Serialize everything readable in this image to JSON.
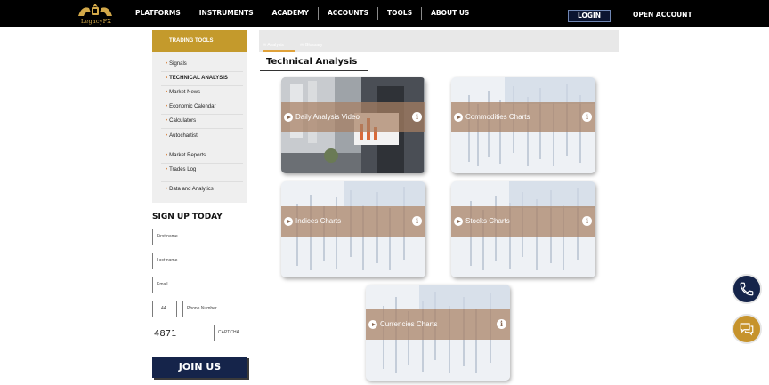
{
  "header": {
    "brand": "LegacyFX",
    "nav": [
      "PLATFORMS",
      "INSTRUMENTS",
      "ACADEMY",
      "ACCOUNTS",
      "TOOLS",
      "ABOUT US"
    ],
    "login_label": "LOGIN",
    "open_account_label": "OPEN ACCOUNT"
  },
  "sidebar": {
    "title": "TRADING TOOLS",
    "items": [
      "Signals",
      "TECHNICAL ANALYSIS",
      "Market News",
      "Economic Calendar",
      "Calculators",
      "Autochartist",
      "Market Reports",
      "Trades Log",
      "Data and Analytics"
    ],
    "active_index": 1
  },
  "signup": {
    "title": "SIGN UP TODAY",
    "first_name_placeholder": "First name",
    "last_name_placeholder": "Last name",
    "email_placeholder": "Email",
    "phone_code_value": "44",
    "phone_placeholder": "Phone Number",
    "captcha_value": "4871",
    "captcha_placeholder": "CAPTCHA",
    "join_label": "JOIN US"
  },
  "main": {
    "tabs": [
      "Analysis",
      "Glossary"
    ],
    "section_title": "Technical Analysis",
    "cards": [
      {
        "label": "Daily Analysis Video",
        "icon": "play-icon"
      },
      {
        "label": "Commodities Charts",
        "icon": "play-icon"
      },
      {
        "label": "Indices Charts",
        "icon": "play-icon"
      },
      {
        "label": "Stocks Charts",
        "icon": "play-icon"
      },
      {
        "label": "Currencies Charts",
        "icon": "play-icon"
      }
    ]
  },
  "colors": {
    "accent_gold": "#c49a2c",
    "navy": "#15244a",
    "band_brown": "#a87f62"
  },
  "floating": {
    "phone_icon": "phone-icon",
    "chat_icon": "chat-icon"
  }
}
